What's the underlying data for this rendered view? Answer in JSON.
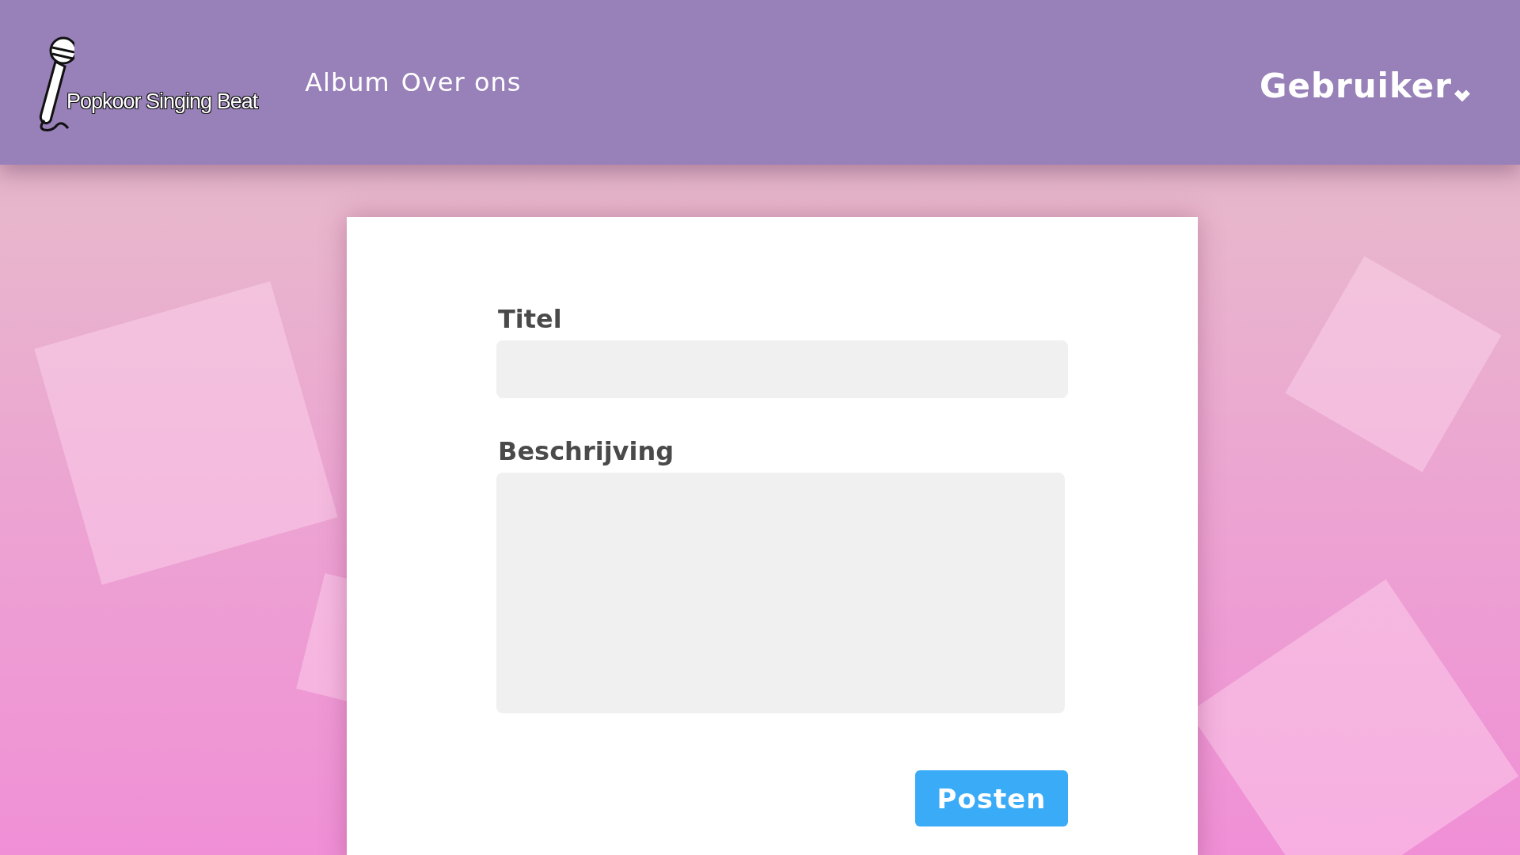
{
  "logo": {
    "text": "Popkoor Singing Beat"
  },
  "nav": [
    {
      "label": "Album"
    },
    {
      "label": "Over ons"
    }
  ],
  "user_menu": {
    "label": "Gebruiker"
  },
  "form": {
    "fields": [
      {
        "kind": "text",
        "label": "Titel"
      },
      {
        "kind": "textarea",
        "label": "Beschrijving"
      }
    ],
    "submit": "Posten"
  }
}
